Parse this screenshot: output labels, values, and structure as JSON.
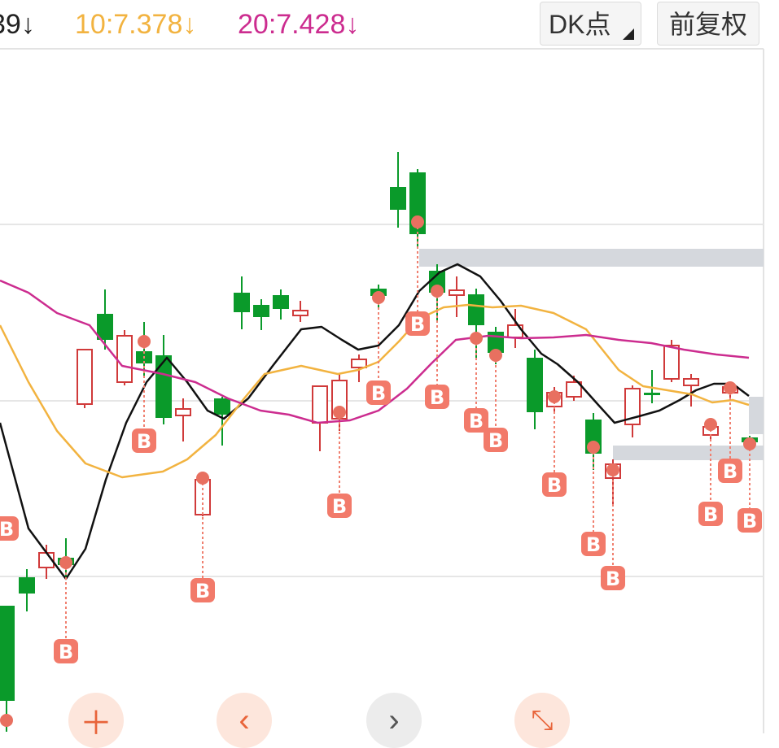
{
  "header": {
    "ma5": "39↓",
    "ma10": "10:7.378↓",
    "ma20": "20:7.428↓",
    "dk_button": "DK点",
    "adjust_button": "前复权"
  },
  "colors": {
    "up": "#d03a3a",
    "down": "#0a9a2a",
    "ma5": "#111111",
    "ma10": "#f2b340",
    "ma20": "#cc2c8f",
    "marker": "#f08070"
  },
  "icons": [
    "zoom-in-icon",
    "chevron-left-icon",
    "chevron-right-icon",
    "fullscreen-icon"
  ],
  "chart_data": {
    "type": "candlestick",
    "buy_marker_label": "B"
  }
}
